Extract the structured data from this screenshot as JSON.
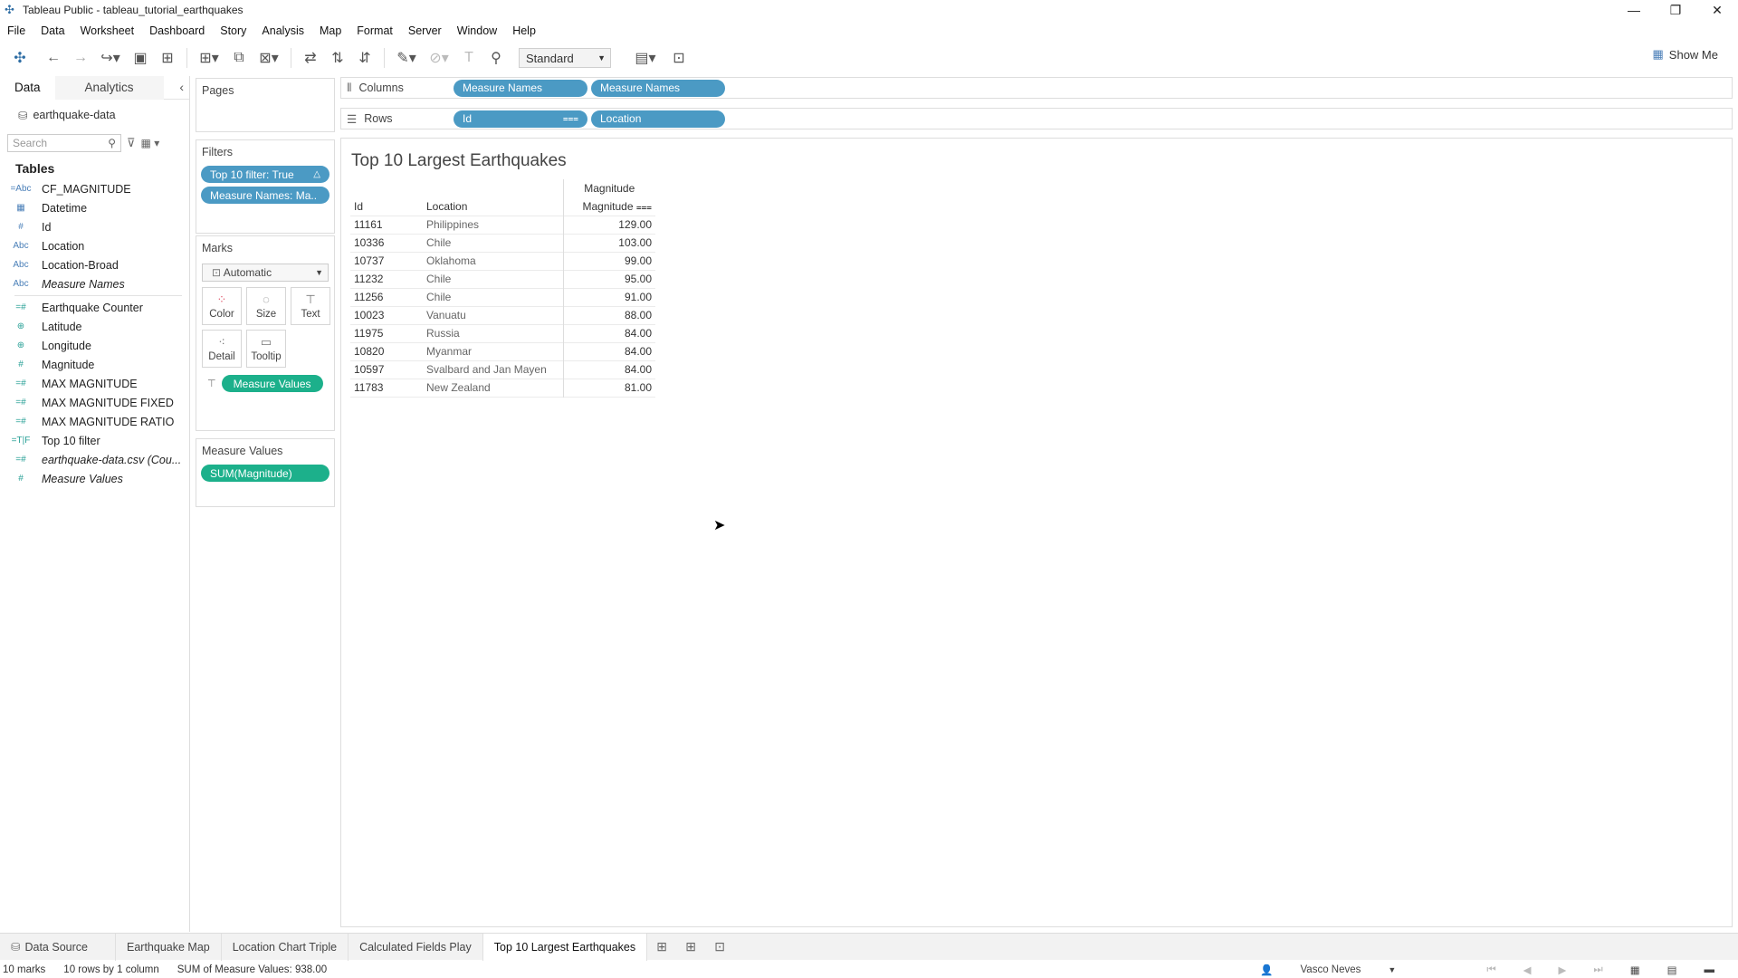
{
  "window": {
    "title": "Tableau Public - tableau_tutorial_earthquakes"
  },
  "menu": [
    "File",
    "Data",
    "Worksheet",
    "Dashboard",
    "Story",
    "Analysis",
    "Map",
    "Format",
    "Server",
    "Window",
    "Help"
  ],
  "toolbar": {
    "fit_select": "Standard",
    "show_me": "Show Me"
  },
  "data_pane": {
    "tab_data": "Data",
    "tab_analytics": "Analytics",
    "source": "earthquake-data",
    "search_placeholder": "Search",
    "tables_label": "Tables",
    "fields": [
      {
        "icon": "=Abc",
        "name": "CF_MAGNITUDE"
      },
      {
        "icon": "▦",
        "name": "Datetime"
      },
      {
        "icon": "#",
        "name": "Id"
      },
      {
        "icon": "Abc",
        "name": "Location"
      },
      {
        "icon": "Abc",
        "name": "Location-Broad"
      },
      {
        "icon": "Abc",
        "name": "Measure Names"
      },
      {
        "icon": "=#",
        "name": "Earthquake Counter"
      },
      {
        "icon": "⊕",
        "name": "Latitude"
      },
      {
        "icon": "⊕",
        "name": "Longitude"
      },
      {
        "icon": "#",
        "name": "Magnitude"
      },
      {
        "icon": "=#",
        "name": "MAX MAGNITUDE"
      },
      {
        "icon": "=#",
        "name": "MAX MAGNITUDE FIXED"
      },
      {
        "icon": "=#",
        "name": "MAX MAGNITUDE RATIO"
      },
      {
        "icon": "=T|F",
        "name": "Top 10 filter"
      },
      {
        "icon": "=#",
        "name": "earthquake-data.csv (Cou..."
      },
      {
        "icon": "#",
        "name": "Measure Values"
      }
    ]
  },
  "cards": {
    "pages_title": "Pages",
    "filters_title": "Filters",
    "filters": [
      "Top 10 filter: True",
      "Measure Names: Ma.."
    ],
    "marks_title": "Marks",
    "marks_type": "Automatic",
    "marks_buttons": [
      "Color",
      "Size",
      "Text",
      "Detail",
      "Tooltip"
    ],
    "marks_pill": "Measure Values",
    "measure_values_title": "Measure Values",
    "measure_values_pill": "SUM(Magnitude)"
  },
  "shelves": {
    "columns_label": "Columns",
    "columns": [
      "Measure Names",
      "Measure Names"
    ],
    "rows_label": "Rows",
    "rows": [
      "Id",
      "Location"
    ]
  },
  "viz": {
    "title": "Top 10 Largest Earthquakes",
    "header_group": "Magnitude",
    "col_id": "Id",
    "col_location": "Location",
    "col_magnitude": "Magnitude",
    "rows": [
      {
        "id": "11161",
        "location": "Philippines",
        "magnitude": "129.00"
      },
      {
        "id": "10336",
        "location": "Chile",
        "magnitude": "103.00"
      },
      {
        "id": "10737",
        "location": "Oklahoma",
        "magnitude": "99.00"
      },
      {
        "id": "11232",
        "location": "Chile",
        "magnitude": "95.00"
      },
      {
        "id": "11256",
        "location": "Chile",
        "magnitude": "91.00"
      },
      {
        "id": "10023",
        "location": "Vanuatu",
        "magnitude": "88.00"
      },
      {
        "id": "11975",
        "location": "Russia",
        "magnitude": "84.00"
      },
      {
        "id": "10820",
        "location": "Myanmar",
        "magnitude": "84.00"
      },
      {
        "id": "10597",
        "location": "Svalbard and Jan Mayen",
        "magnitude": "84.00"
      },
      {
        "id": "11783",
        "location": "New Zealand",
        "magnitude": "81.00"
      }
    ]
  },
  "sheet_tabs": [
    "Data Source",
    "Earthquake Map",
    "Location Chart Triple",
    "Calculated Fields Play",
    "Top 10 Largest Earthquakes"
  ],
  "active_sheet": "Top 10 Largest Earthquakes",
  "status": {
    "marks": "10 marks",
    "rows_cols": "10 rows by 1 column",
    "sum": "SUM of Measure Values: 938.00",
    "user": "Vasco Neves"
  }
}
